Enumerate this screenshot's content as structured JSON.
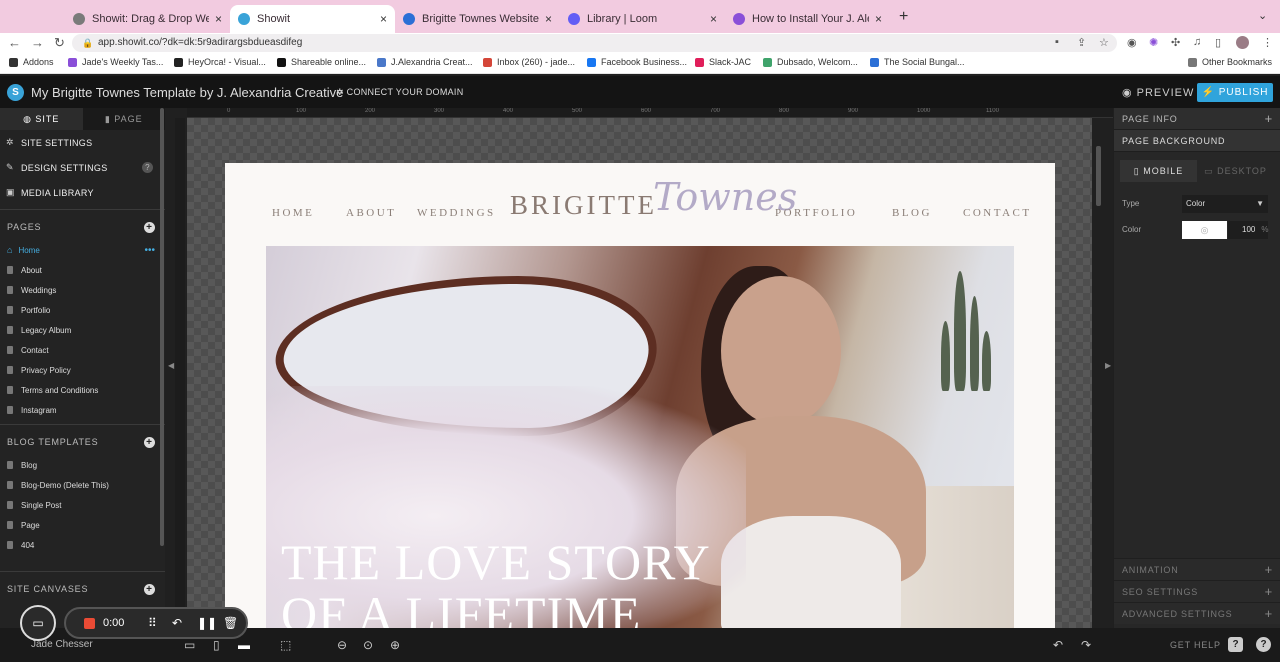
{
  "browser": {
    "tabs": [
      {
        "title": "Showit: Drag & Drop Website B",
        "color": "#7a7a7a",
        "active": false
      },
      {
        "title": "Showit",
        "color": "#39a3d8",
        "active": true
      },
      {
        "title": "Brigitte Townes Website Launc",
        "color": "#2b6fd6",
        "active": false
      },
      {
        "title": "Library | Loom",
        "color": "#625df5",
        "active": false
      },
      {
        "title": "How to Install Your J. Alexandria",
        "color": "#8a4fd8",
        "active": false
      }
    ],
    "close_glyph": "×",
    "new_tab_glyph": "+",
    "url": "app.showit.co/?dk=dk:5r9adirargsbdueasdifeg",
    "bookmarks": [
      "Addons",
      "Jade's Weekly Tas...",
      "HeyOrca! - Visual...",
      "Shareable online...",
      "J.Alexandria Creat...",
      "Inbox (260) - jade...",
      "Facebook Business...",
      "Slack-JAC",
      "Dubsado, Welcom...",
      "The Social Bungal..."
    ],
    "other_bookmarks": "Other Bookmarks"
  },
  "app": {
    "title": "My Brigitte Townes Template by J. Alexandria Creative",
    "connect_domain": "CONNECT YOUR DOMAIN",
    "preview": "PREVIEW",
    "publish": "PUBLISH",
    "accent": "#30a4dc"
  },
  "sidebar": {
    "tab_site": "SITE",
    "tab_page": "PAGE",
    "site_settings": "SITE SETTINGS",
    "design_settings": "DESIGN SETTINGS",
    "media_library": "MEDIA LIBRARY",
    "pages_heading": "PAGES",
    "pages": [
      "Home",
      "About",
      "Weddings",
      "Portfolio",
      "Legacy Album",
      "Contact",
      "Privacy Policy",
      "Terms and Conditions",
      "Instagram"
    ],
    "blog_heading": "BLOG TEMPLATES",
    "blog_templates": [
      "Blog",
      "Blog-Demo (Delete This)",
      "Single Post",
      "Page",
      "404"
    ],
    "canvases_heading": "SITE CANVASES"
  },
  "ruler": [
    "0",
    "100",
    "200",
    "300",
    "400",
    "500",
    "600",
    "700",
    "800",
    "900",
    "1000",
    "1100"
  ],
  "site": {
    "nav_left": [
      "HOME",
      "ABOUT",
      "WEDDINGS"
    ],
    "brand": "BRIGITTE",
    "brand_script": "Townes",
    "nav_right": [
      "PORTFOLIO",
      "BLOG",
      "CONTACT"
    ],
    "hero_line1": "THE LOVE STORY",
    "hero_line2": "OF A LIFETIME"
  },
  "right_panel": {
    "page_info": "PAGE INFO",
    "page_background": "PAGE BACKGROUND",
    "mobile": "MOBILE",
    "desktop": "DESKTOP",
    "type_label": "Type",
    "type_value": "Color",
    "color_label": "Color",
    "opacity": "100",
    "opacity_unit": "%",
    "animation": "ANIMATION",
    "seo_settings": "SEO SETTINGS",
    "advanced_settings": "ADVANCED SETTINGS"
  },
  "bottom": {
    "user": "Jade Chesser",
    "get_help": "GET HELP",
    "help_glyph": "?",
    "question_glyph": "?"
  },
  "loom": {
    "time": "0:00"
  }
}
